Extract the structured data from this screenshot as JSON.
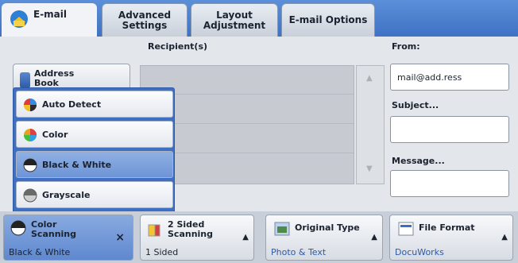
{
  "tabs": [
    {
      "label": "E-mail",
      "active": true
    },
    {
      "label": "Advanced Settings",
      "active": false
    },
    {
      "label": "Layout Adjustment",
      "active": false
    },
    {
      "label": "E-mail Options",
      "active": false
    }
  ],
  "labels": {
    "recipients": "Recipient(s)",
    "from": "From:",
    "subject": "Subject...",
    "message": "Message..."
  },
  "address_book": {
    "label": "Address Book"
  },
  "from_value": "mail@add.ress",
  "color_options": [
    {
      "label": "Auto Detect",
      "selected": false
    },
    {
      "label": "Color",
      "selected": false
    },
    {
      "label": "Black & White",
      "selected": true
    },
    {
      "label": "Grayscale",
      "selected": false
    }
  ],
  "bottom_buttons": {
    "color": {
      "title": "Color Scanning",
      "value": "Black & White"
    },
    "sided": {
      "title": "2 Sided Scanning",
      "value": "1 Sided"
    },
    "original_type": {
      "title": "Original Type",
      "value": "Photo & Text"
    },
    "file_format": {
      "title": "File Format",
      "value": "DocuWorks"
    }
  },
  "colors": {
    "tabbar": "#4a80cc",
    "selected": "#7a9fdb",
    "value_text": "#2c5aa8"
  }
}
